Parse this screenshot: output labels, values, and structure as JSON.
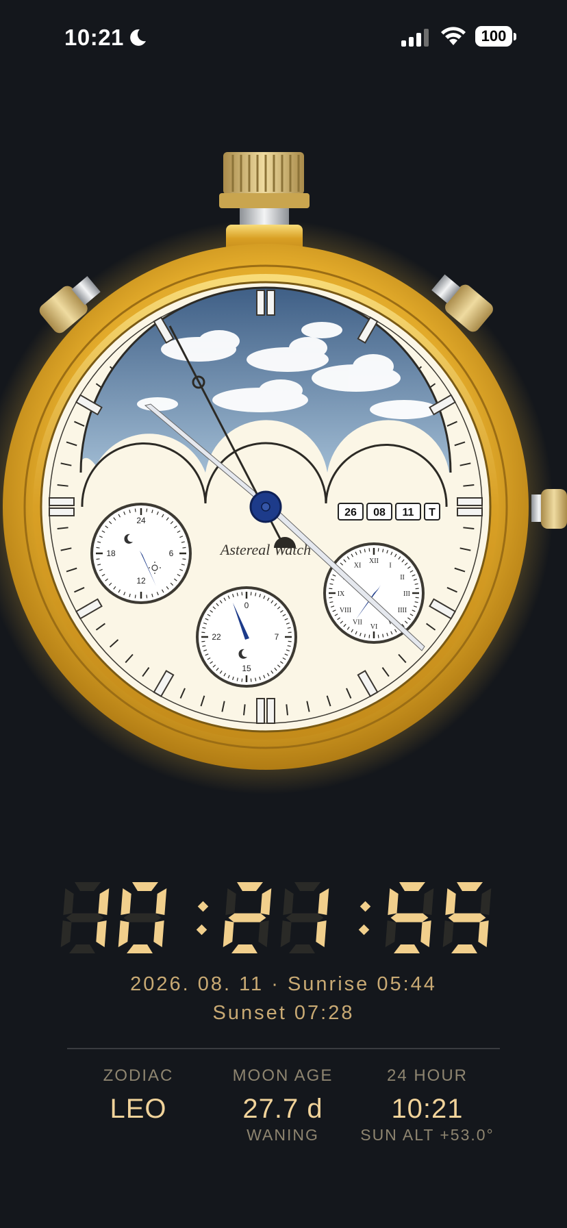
{
  "status_bar": {
    "time": "10:21",
    "battery": "100"
  },
  "watch": {
    "brand": "Astereal Watch",
    "date_windows": [
      "26",
      "08",
      "11",
      "T"
    ],
    "roman_numerals": [
      "XII",
      "I",
      "II",
      "III",
      "IIII",
      "V",
      "VI",
      "VII",
      "VIII",
      "IX",
      "X",
      "XI"
    ],
    "subdial_left_labels": [
      "24",
      "6",
      "12",
      "18"
    ],
    "subdial_bottom_labels": [
      "0",
      "7",
      "15",
      "22"
    ],
    "colors": {
      "case_gold": "#e5b02e",
      "dial_cream": "#fbf6e6",
      "hand_blue": "#1d3b8a",
      "sky_blue": "#7d9bbb"
    }
  },
  "digital_clock": {
    "hours": "10",
    "minutes": "21",
    "seconds": "55",
    "separator": ":"
  },
  "date_line": "2026. 08. 11  ·  Sunrise 05:44",
  "sunset_line": "Sunset 07:28",
  "info": {
    "zodiac": {
      "label": "ZODIAC",
      "value": "LEO"
    },
    "moon_age": {
      "label": "MOON AGE",
      "value": "27.7 d",
      "sub": "WANING"
    },
    "hour24": {
      "label": "24 HOUR",
      "value": "10:21",
      "sub": "SUN ALT +53.0°"
    }
  }
}
